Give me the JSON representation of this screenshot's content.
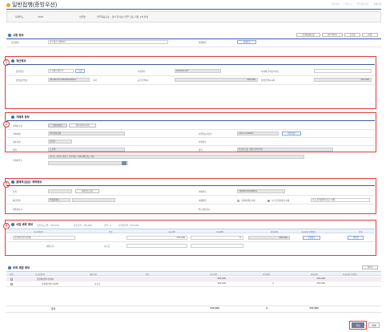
{
  "page": {
    "title": "일반접행(증빙우선)",
    "nav": [
      "업무지시",
      "기안도구",
      "업무회의 검토",
      "결재설정"
    ]
  },
  "infobar": {
    "label1": "회계연도",
    "value1": "2016",
    "label2": "사업명",
    "value2": "업무목표조정 _ 관리 유지보수업무 검토 지원_1차 확정"
  },
  "basic": {
    "title": "사용 정보",
    "buttons": [
      "사업비현황조회",
      "이전 페이지",
      "초기화",
      "인쇄"
    ],
    "label_a": "집행명칭",
    "value_a": "사무용기 집행처리",
    "label_b": "결재방법",
    "value_b": "결재참조"
  },
  "s1": {
    "title": "계산정보",
    "pay_label": "증빙유형",
    "pay_value": "전자세금계산서",
    "pay_btn": "조회",
    "date_label": "작성일자",
    "date_value": "2016-01-07",
    "tax_label": "지자체 문화공적(이)",
    "tax_value": "",
    "approval_label": "증빙승인번호",
    "approval_value": "20160107100000000012",
    "approval_btn": "출처",
    "amount_label": "공급가액(A)",
    "amount_value": "350,000",
    "total_label": "합계금액(A+B)",
    "total_value": "350,000"
  },
  "s2": {
    "title": "거래처 정보",
    "type_label": "거래처구분",
    "type_btns": [
      "법인사업자",
      "개인사업자(국내)"
    ],
    "name_label": "거래처명",
    "name_value": "일반용품상점",
    "reg_label": "사업자등록번호",
    "reg_value": "124-17-60060",
    "reg_btn": "사업자확인",
    "rep_label": "대표자명",
    "rep_value": "김진호",
    "phone_label": "전화번호",
    "phone_value": "",
    "biz_label": "업태",
    "biz_value": "도소매",
    "item_label": "종목",
    "item_value": "전산소모품, 컴퓨터주변기기",
    "addr_label": "거래처주소",
    "addr_value": "경기도 수원시 영통구 경수대로 1025(매탄동, 1층)"
  },
  "s3": {
    "title": "결제처(입금) 계좌정보",
    "bank_label": "은행",
    "bank_value": "",
    "bank_btn": "계좌번호 조회",
    "acct_label": "계좌번호",
    "acct_value": "74600101428631",
    "holder_label": "예금주명",
    "holder_value": "작성된예금",
    "method_label": "이체방법",
    "method_opts": [
      "거래처계좌 이체",
      "보조금전용계좌 이체",
      "보조금전용계좌 출금 이체"
    ],
    "memo_label": "내통장표시",
    "memo_value": "",
    "recv_label": "받는통장표시",
    "recv_value": ""
  },
  "s4": {
    "title": "사업 세목 정보",
    "summary": [
      "집행가능금액 : 350,000",
      "집행금액 : 350,000",
      "잔액 : 0",
      "사업비잔액 : 350,000"
    ],
    "headers": [
      "보조세목/목",
      "항목",
      "공급가액",
      "부가세액",
      "집행금액",
      "지급대상 인력정보",
      "삭제"
    ],
    "row": {
      "item": "운영비(일반수용비)",
      "supply": "350,000",
      "vat": "0",
      "amount": "350,000",
      "person_btn": "인력정보",
      "del_btn": "행삭제"
    },
    "fund_label": "재원구분",
    "fund_value": "보조금"
  },
  "s5": {
    "title": "비목 재원 정보",
    "add_btn": "행추가",
    "headers": [
      "선택",
      "보조세목/목",
      "재원구분",
      "항목",
      "공급가액",
      "부가세액",
      "집행금액",
      "지급대상 인력정보"
    ],
    "rows": [
      {
        "name": "운영비(일반수용비)",
        "fund": "",
        "supply": "350,000",
        "vat": "",
        "amount": "350,000"
      },
      {
        "name": "운영비(일반수용비)",
        "fund": "보조금",
        "supply": "350,000",
        "vat": "0",
        "amount": "350,000"
      }
    ],
    "total_label": "합계",
    "totals": [
      "350,000",
      "0",
      "350,000"
    ]
  },
  "footer": {
    "save": "저장",
    "list": "목록"
  },
  "colors": {
    "accent": "#3a5aa8",
    "highlight": "#e23c3c"
  }
}
